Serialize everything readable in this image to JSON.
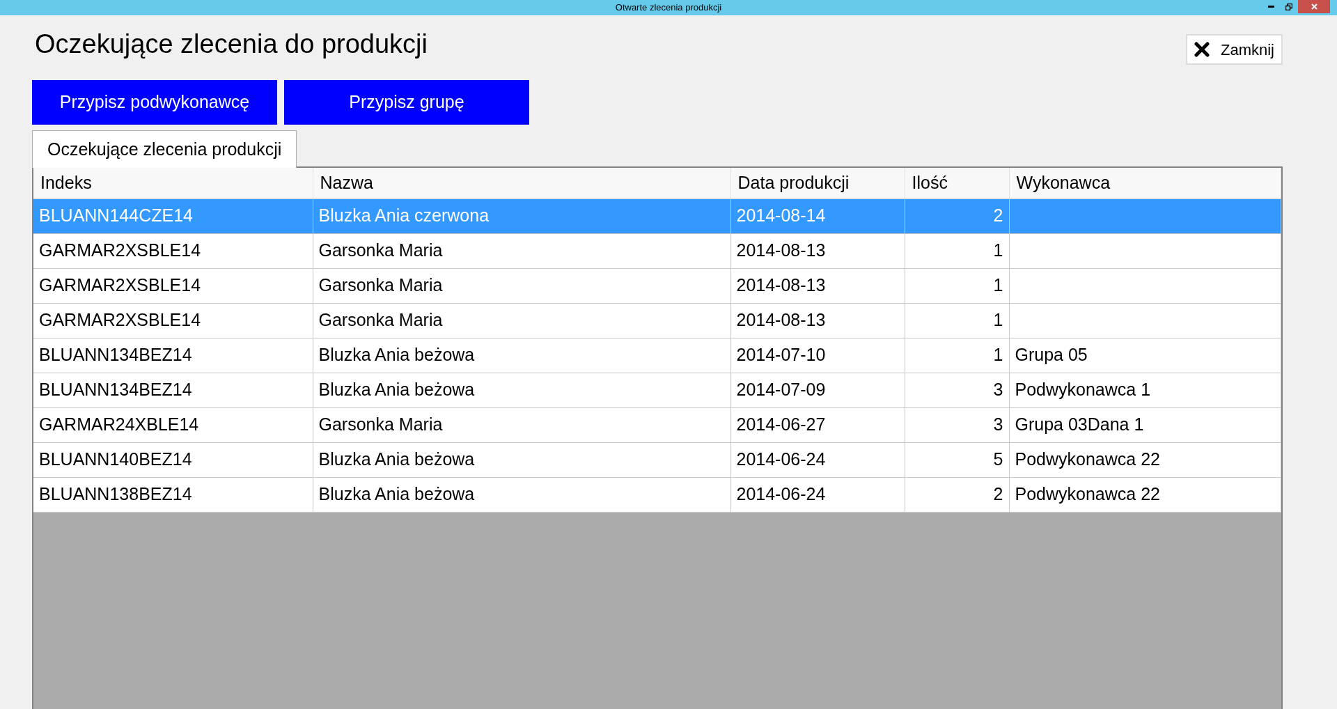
{
  "window": {
    "title": "Otwarte zlecenia produkcji"
  },
  "heading": "Oczekujące zlecenia do produkcji",
  "close_button": {
    "label": "Zamknij"
  },
  "actions": [
    "Przypisz podwykonawcę",
    "Przypisz grupę"
  ],
  "tabs": [
    {
      "label": "Oczekujące zlecenia produkcji",
      "selected": true
    }
  ],
  "table": {
    "columns": [
      "Indeks",
      "Nazwa",
      "Data produkcji",
      "Ilość",
      "Wykonawca"
    ],
    "rows": [
      {
        "cells": [
          "BLUANN144CZE14",
          "Bluzka Ania czerwona",
          "2014-08-14",
          "2",
          ""
        ],
        "selected": true
      },
      {
        "cells": [
          "GARMAR2XSBLE14",
          "Garsonka Maria",
          "2014-08-13",
          "1",
          ""
        ],
        "selected": false
      },
      {
        "cells": [
          "GARMAR2XSBLE14",
          "Garsonka Maria",
          "2014-08-13",
          "1",
          ""
        ],
        "selected": false
      },
      {
        "cells": [
          "GARMAR2XSBLE14",
          "Garsonka Maria",
          "2014-08-13",
          "1",
          ""
        ],
        "selected": false
      },
      {
        "cells": [
          "BLUANN134BEZ14",
          "Bluzka Ania beżowa",
          "2014-07-10",
          "1",
          "Grupa 05"
        ],
        "selected": false
      },
      {
        "cells": [
          "BLUANN134BEZ14",
          "Bluzka Ania beżowa",
          "2014-07-09",
          "3",
          "Podwykonawca 1"
        ],
        "selected": false
      },
      {
        "cells": [
          "GARMAR24XBLE14",
          "Garsonka Maria",
          "2014-06-27",
          "3",
          "Grupa 03Dana 1"
        ],
        "selected": false
      },
      {
        "cells": [
          "BLUANN140BEZ14",
          "Bluzka Ania beżowa",
          "2014-06-24",
          "5",
          "Podwykonawca 22"
        ],
        "selected": false
      },
      {
        "cells": [
          "BLUANN138BEZ14",
          "Bluzka Ania beżowa",
          "2014-06-24",
          "2",
          "Podwykonawca 22"
        ],
        "selected": false
      }
    ]
  }
}
